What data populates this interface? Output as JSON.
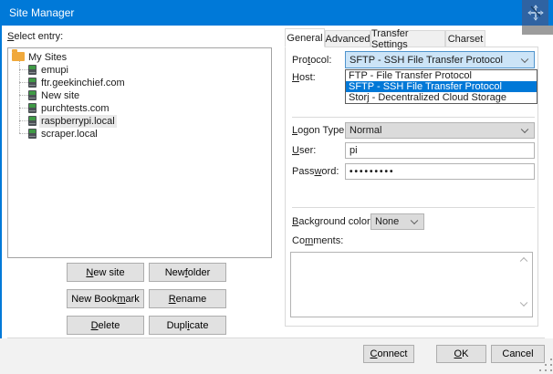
{
  "window": {
    "title": "Site Manager"
  },
  "left_panel": {
    "select_entry_label": {
      "text": "Select entry:",
      "mnemonic": 0
    },
    "tree": {
      "root": {
        "label": "My Sites"
      },
      "items": [
        {
          "label": "emupi",
          "selected": false
        },
        {
          "label": "ftr.geekinchief.com",
          "selected": false
        },
        {
          "label": "New site",
          "selected": false
        },
        {
          "label": "purchtests.com",
          "selected": false
        },
        {
          "label": "raspberrypi.local",
          "selected": true
        },
        {
          "label": "scraper.local",
          "selected": false
        }
      ]
    },
    "buttons": {
      "new_site": {
        "text": "New site",
        "mnemonic": 0
      },
      "new_folder": {
        "text": "New folder",
        "mnemonic": 4
      },
      "new_bookmark": {
        "text": "New Bookmark",
        "mnemonic": 8
      },
      "rename": {
        "text": "Rename",
        "mnemonic": 0
      },
      "delete": {
        "text": "Delete",
        "mnemonic": 0
      },
      "duplicate": {
        "text": "Duplicate",
        "mnemonic": 4
      }
    }
  },
  "tabs": {
    "items": [
      {
        "label": "General",
        "active": true
      },
      {
        "label": "Advanced",
        "active": false
      },
      {
        "label": "Transfer Settings",
        "active": false
      },
      {
        "label": "Charset",
        "active": false
      }
    ]
  },
  "general_tab": {
    "protocol": {
      "label": {
        "text": "Protocol:",
        "mnemonic": 3
      },
      "value": "SFTP - SSH File Transfer Protocol",
      "dropdown_open": true,
      "options": [
        {
          "label": "FTP - File Transfer Protocol",
          "highlighted": false
        },
        {
          "label": "SFTP - SSH File Transfer Protocol",
          "highlighted": true
        },
        {
          "label": "Storj - Decentralized Cloud Storage",
          "highlighted": false
        }
      ]
    },
    "host": {
      "label": {
        "text": "Host:",
        "mnemonic": 0
      },
      "value": ""
    },
    "logon_type": {
      "label": {
        "text": "Logon Type:",
        "mnemonic": 0
      },
      "value": "Normal"
    },
    "user": {
      "label": {
        "text": "User:",
        "mnemonic": 0
      },
      "value": "pi"
    },
    "password": {
      "label": {
        "text": "Password:",
        "mnemonic": 4
      },
      "masked_value": "•••••••••"
    },
    "background_color": {
      "label": {
        "text": "Background color:",
        "mnemonic": 0
      },
      "value": "None"
    },
    "comments": {
      "label": {
        "text": "Comments:",
        "mnemonic": 2
      },
      "value": ""
    }
  },
  "footer": {
    "connect": {
      "text": "Connect",
      "mnemonic": 0
    },
    "ok": {
      "text": "OK",
      "mnemonic": 0
    },
    "cancel": {
      "text": "Cancel",
      "mnemonic": -1
    }
  },
  "colors": {
    "titlebar": "#0079d8",
    "selection": "#0078d7",
    "combo_selected_bg": "#cce4f7",
    "button_bg": "#e1e1e1",
    "folder_icon": "#f0a93c"
  }
}
